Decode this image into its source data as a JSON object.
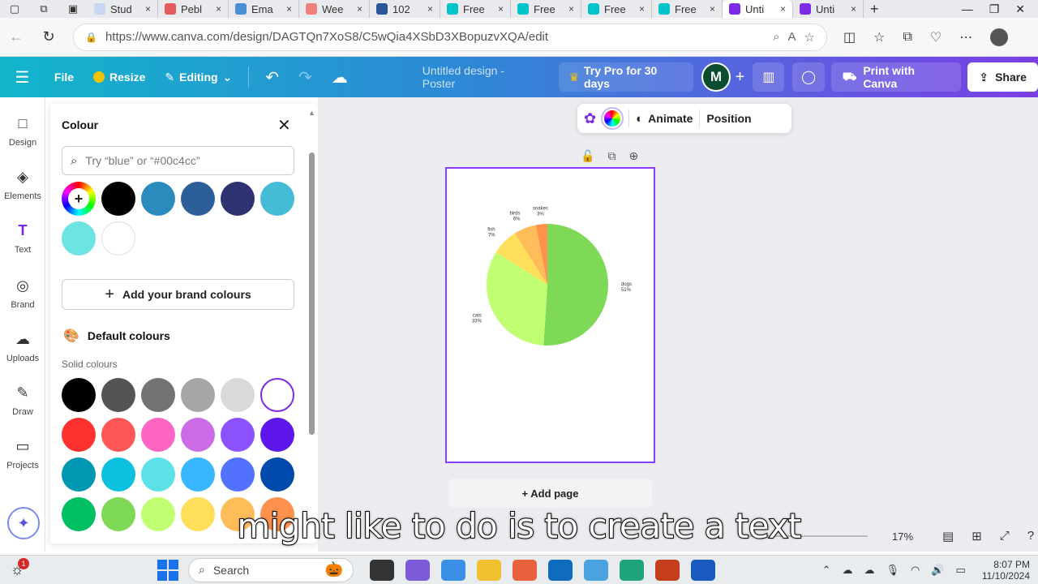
{
  "browser": {
    "tabs": [
      {
        "label": "Stud",
        "color": "#c8d6f0"
      },
      {
        "label": "Pebl",
        "color": "#e65c5c"
      },
      {
        "label": "Ema",
        "color": "#4a8fd6"
      },
      {
        "label": "Wee",
        "color": "#f08080"
      },
      {
        "label": "102",
        "color": "#2b579a"
      },
      {
        "label": "Free",
        "color": "#00c4cc"
      },
      {
        "label": "Free",
        "color": "#00c4cc"
      },
      {
        "label": "Free",
        "color": "#00c4cc"
      },
      {
        "label": "Free",
        "color": "#00c4cc"
      },
      {
        "label": "Unti",
        "color": "#7d2ae8"
      },
      {
        "label": "Unti",
        "color": "#7d2ae8"
      }
    ],
    "url": "https://www.canva.com/design/DAGTQn7XoS8/C5wQia4XSbD3XBopuzvXQA/edit"
  },
  "canva_top": {
    "file_label": "File",
    "resize_label": "Resize",
    "editing_label": "Editing",
    "design_title": "Untitled design - Poster",
    "try_pro_label": "Try Pro for 30 days",
    "avatar_initial": "M",
    "print_label": "Print with Canva",
    "share_label": "Share"
  },
  "rail": {
    "items": [
      {
        "label": "Design",
        "icon": "□"
      },
      {
        "label": "Elements",
        "icon": "◈"
      },
      {
        "label": "Text",
        "icon": "T"
      },
      {
        "label": "Brand",
        "icon": "◎"
      },
      {
        "label": "Uploads",
        "icon": "☁"
      },
      {
        "label": "Draw",
        "icon": "✎"
      },
      {
        "label": "Projects",
        "icon": "▭"
      }
    ]
  },
  "colour_panel": {
    "title": "Colour",
    "search_placeholder": "Try “blue” or “#00c4cc”",
    "document_colours": [
      "#000000",
      "#2b8bbd",
      "#2c5f99",
      "#2f3270",
      "#45bcd6",
      "#6ce4e4",
      "#ffffff"
    ],
    "add_brand_label": "Add your brand colours",
    "default_heading": "Default colours",
    "solid_label": "Solid colours",
    "solid_colours": [
      [
        "#000000",
        "#545454",
        "#737373",
        "#a6a6a6",
        "#d9d9d9",
        "#ffffff"
      ],
      [
        "#ff3131",
        "#ff5757",
        "#ff66c4",
        "#cb6ce6",
        "#8c52ff",
        "#5e17eb"
      ],
      [
        "#0097b2",
        "#0cc0df",
        "#5ce1e6",
        "#38b6ff",
        "#5271ff",
        "#004aad"
      ],
      [
        "#00bf63",
        "#7ed957",
        "#c1ff72",
        "#ffde59",
        "#ffbd59",
        "#ff914d"
      ]
    ]
  },
  "context_toolbar": {
    "animate_label": "Animate",
    "position_label": "Position"
  },
  "chart_data": {
    "type": "pie",
    "categories": [
      "dogs",
      "cats",
      "fish",
      "birds",
      "snakes"
    ],
    "values": [
      51,
      33,
      7,
      6,
      3
    ],
    "value_labels": [
      "51%",
      "33%",
      "7%",
      "6%",
      "3%"
    ],
    "colors": [
      "#7ed957",
      "#c1ff72",
      "#ffde59",
      "#ffbd59",
      "#ff914d"
    ]
  },
  "add_page_label": "+ Add page",
  "zoom_label": "17%",
  "caption": "might like to do is to create a text",
  "taskbar": {
    "search_label": "Search",
    "notif_count": "1",
    "time": "8:07 PM",
    "date": "11/10/2024"
  }
}
